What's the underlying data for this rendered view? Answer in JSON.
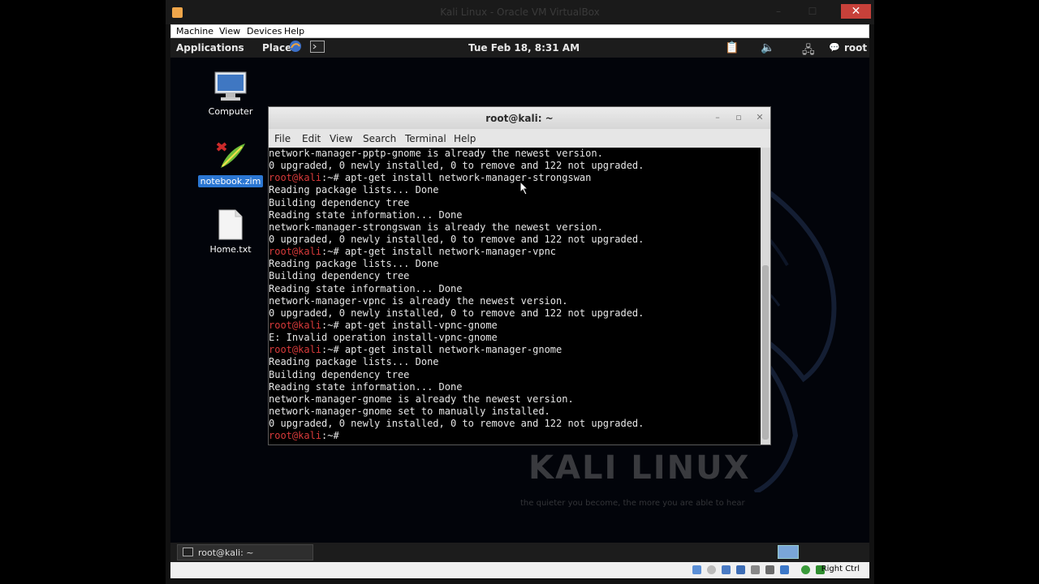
{
  "virtualbox": {
    "window_title": "Kali Linux - Oracle VM VirtualBox",
    "menu": [
      "Machine",
      "View",
      "Devices",
      "Help"
    ],
    "status_host_key": "Right Ctrl"
  },
  "guest": {
    "top_panel": {
      "applications": "Applications",
      "places": "Places",
      "clock": "Tue Feb 18,  8:31 AM",
      "user": "root"
    },
    "desktop_icons": [
      {
        "label": "Computer",
        "icon": "computer-icon"
      },
      {
        "label": "notebook.zim",
        "icon": "zim-notebook-icon",
        "selected": true
      },
      {
        "label": "Home.txt",
        "icon": "text-file-icon"
      }
    ],
    "wallpaper": {
      "brand": "KALI LINUX",
      "tagline": "the quieter you become, the more you are able to hear"
    },
    "terminal": {
      "title": "root@kali: ~",
      "menu": [
        "File",
        "Edit",
        "View",
        "Search",
        "Terminal",
        "Help"
      ],
      "prompt": "root@kali",
      "lines": [
        {
          "text": "network-manager-pptp-gnome is already the newest version."
        },
        {
          "text": "0 upgraded, 0 newly installed, 0 to remove and 122 not upgraded."
        },
        {
          "prompt": true,
          "text": ":~# apt-get install network-manager-strongswan"
        },
        {
          "text": "Reading package lists... Done"
        },
        {
          "text": "Building dependency tree"
        },
        {
          "text": "Reading state information... Done"
        },
        {
          "text": "network-manager-strongswan is already the newest version."
        },
        {
          "text": "0 upgraded, 0 newly installed, 0 to remove and 122 not upgraded."
        },
        {
          "prompt": true,
          "text": ":~# apt-get install network-manager-vpnc"
        },
        {
          "text": "Reading package lists... Done"
        },
        {
          "text": "Building dependency tree"
        },
        {
          "text": "Reading state information... Done"
        },
        {
          "text": "network-manager-vpnc is already the newest version."
        },
        {
          "text": "0 upgraded, 0 newly installed, 0 to remove and 122 not upgraded."
        },
        {
          "prompt": true,
          "text": ":~# apt-get install-vpnc-gnome"
        },
        {
          "text": "E: Invalid operation install-vpnc-gnome"
        },
        {
          "prompt": true,
          "text": ":~# apt-get install network-manager-gnome"
        },
        {
          "text": "Reading package lists... Done"
        },
        {
          "text": "Building dependency tree"
        },
        {
          "text": "Reading state information... Done"
        },
        {
          "text": "network-manager-gnome is already the newest version."
        },
        {
          "text": "network-manager-gnome set to manually installed."
        },
        {
          "text": "0 upgraded, 0 newly installed, 0 to remove and 122 not upgraded."
        },
        {
          "prompt": true,
          "text": ":~# "
        }
      ]
    },
    "bottom_panel": {
      "task_label": "root@kali: ~"
    }
  },
  "colors": {
    "prompt": "#d93a3a",
    "selection": "#2b77d3"
  }
}
